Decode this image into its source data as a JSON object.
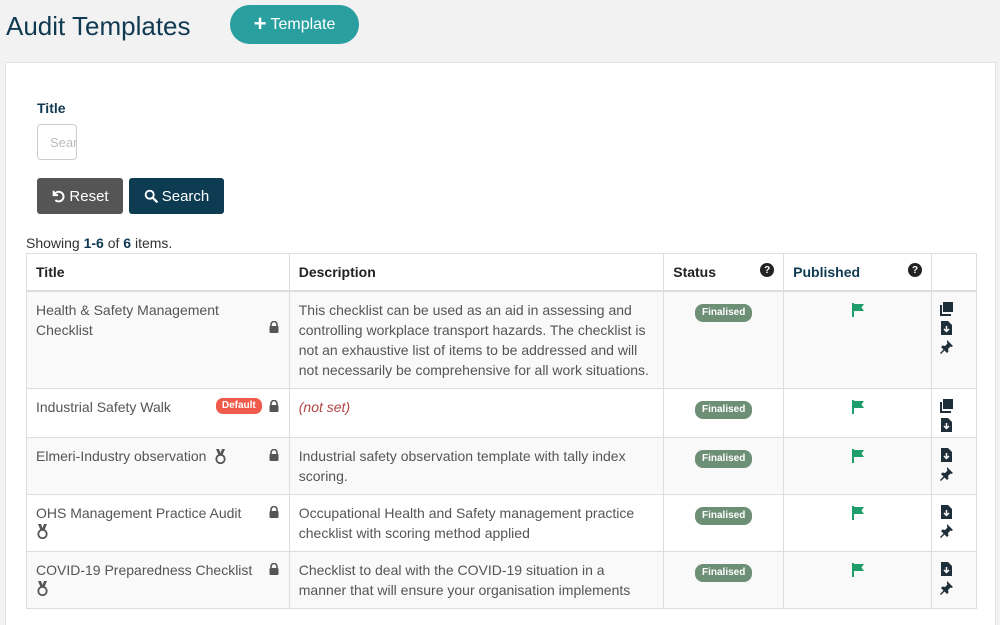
{
  "header": {
    "title": "Audit Templates",
    "add_label": "Template"
  },
  "filter": {
    "title_label": "Title",
    "title_placeholder": "Search",
    "reset_label": "Reset",
    "search_label": "Search"
  },
  "summary": {
    "prefix": "Showing ",
    "range": "1-6",
    "of": " of ",
    "total": "6",
    "suffix": " items."
  },
  "table": {
    "columns": [
      "Title",
      "Description",
      "Status",
      "Published",
      ""
    ],
    "rows": [
      {
        "title": "Health & Safety Management Checklist",
        "description": "This checklist can be used as an aid in assessing and controlling workplace transport hazards. The checklist is not an exhaustive list of items to be addressed and will not necessarily be comprehensive for all work situations.",
        "status": "Finalised",
        "default_badge": "",
        "actions": [
          "copy-icon",
          "download-icon",
          "pin-icon"
        ]
      },
      {
        "title": "Industrial Safety Walk",
        "description": "(not set)",
        "status": "Finalised",
        "default_badge": "Default",
        "actions": [
          "copy-icon",
          "download-icon"
        ]
      },
      {
        "title": "Elmeri-Industry observation",
        "description": "Industrial safety observation template with tally index scoring.",
        "status": "Finalised",
        "default_badge": "",
        "actions": [
          "download-icon",
          "pin-icon"
        ]
      },
      {
        "title": "OHS Management Practice Audit",
        "description": "Occupational Health and Safety management practice checklist with scoring method applied",
        "status": "Finalised",
        "default_badge": "",
        "actions": [
          "download-icon",
          "pin-icon"
        ]
      },
      {
        "title": "COVID-19 Preparedness Checklist",
        "description": "Checklist to deal with the COVID-19 situation in a manner that will ensure your organisation implements",
        "status": "Finalised",
        "default_badge": "",
        "actions": [
          "download-icon",
          "pin-icon"
        ]
      }
    ]
  },
  "colors": {
    "brand_teal": "#2a9fa0",
    "navy": "#0d3b52",
    "status_green": "#6d8f75",
    "flag_green": "#1e9e6a",
    "default_red": "#f05a4a"
  }
}
